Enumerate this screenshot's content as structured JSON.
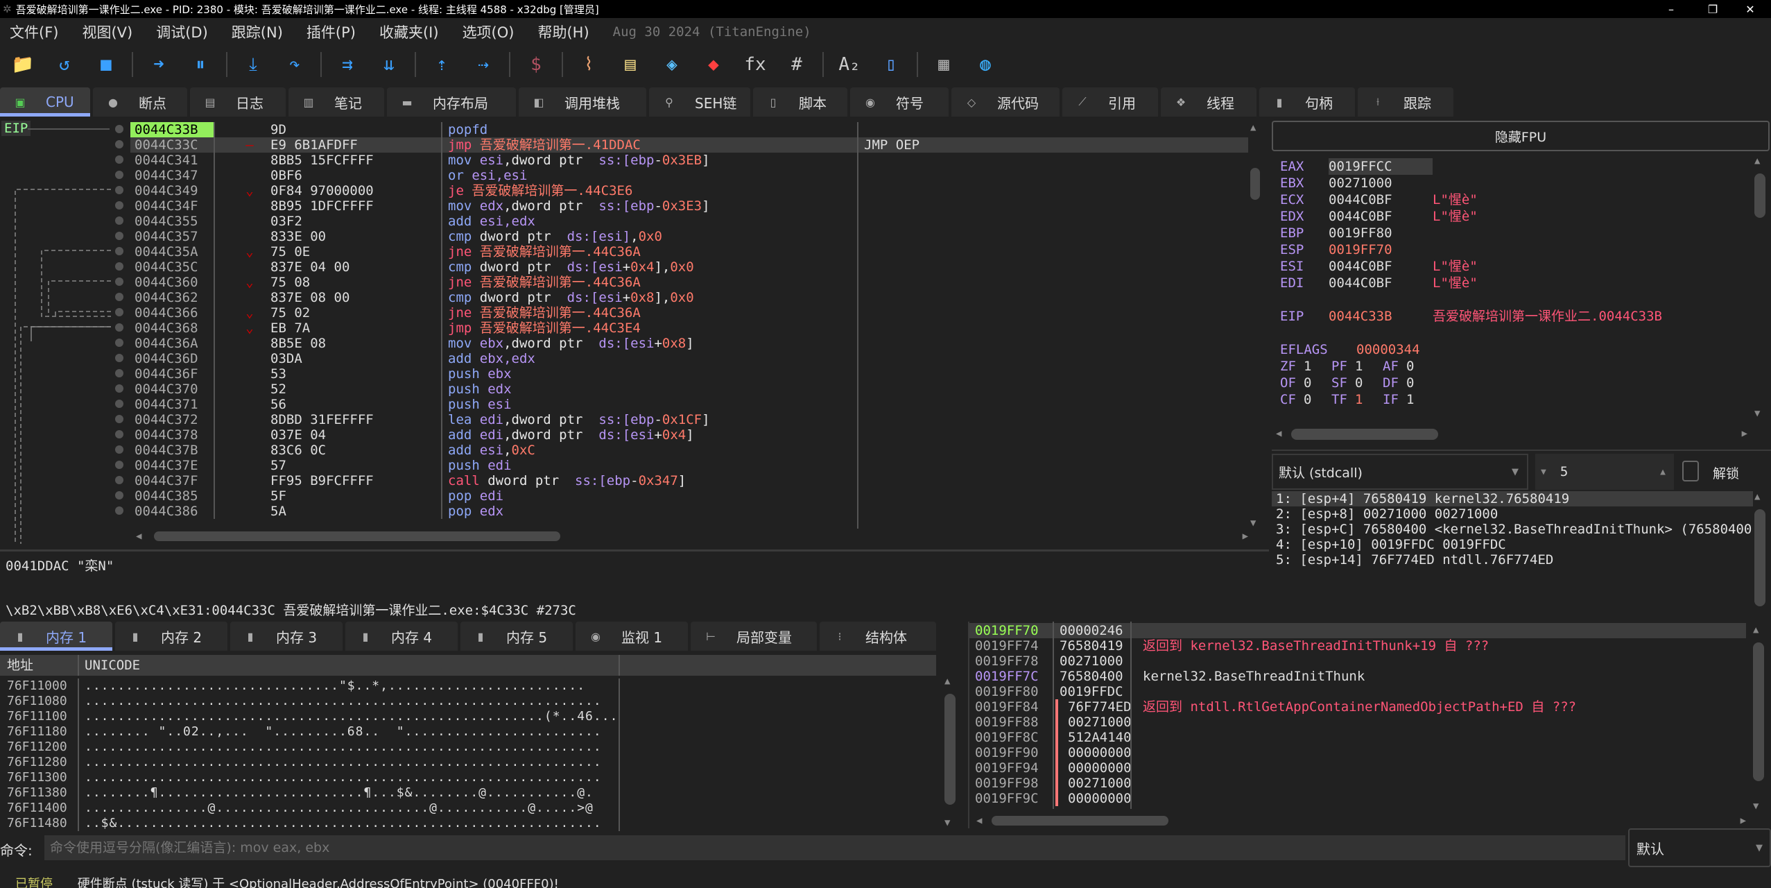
{
  "window": {
    "title": "吾爱破解培训第一课作业二.exe - PID: 2380 - 模块: 吾爱破解培训第一课作业二.exe - 线程: 主线程 4588 - x32dbg [管理员]",
    "min": "–",
    "max": "❐",
    "close": "✕"
  },
  "menu": {
    "items": [
      "文件(F)",
      "视图(V)",
      "调试(D)",
      "跟踪(N)",
      "插件(P)",
      "收藏夹(I)",
      "选项(O)",
      "帮助(H)"
    ],
    "version": "Aug 30 2024 (TitanEngine)"
  },
  "toolbar": {
    "icons": [
      "open-icon",
      "restart-icon",
      "stop-icon",
      "run-icon",
      "pause-icon",
      "step-into-icon",
      "step-over-icon",
      "trace-into-icon",
      "trace-over-icon",
      "execute-till-return-icon",
      "run-to-user-code-icon",
      "scylla-icon",
      "patch-icon",
      "comment-icon",
      "label-icon",
      "bookmark-icon",
      "function-icon",
      "hash-icon",
      "strings-icon",
      "calls-icon",
      "calculator-icon",
      "globe-icon"
    ],
    "glyphs": [
      "📁",
      "↺",
      "■",
      "➜",
      "⏸",
      "⤓",
      "↷",
      "⇉",
      "⇊",
      "⇡",
      "⇢",
      "$",
      "⌇",
      "▤",
      "◈",
      "◆",
      "fx",
      "#",
      "A₂",
      "▯",
      "▦",
      "◍"
    ]
  },
  "main_tabs": [
    {
      "label": "CPU",
      "icon": "▣"
    },
    {
      "label": "断点",
      "icon": "●"
    },
    {
      "label": "日志",
      "icon": "▤"
    },
    {
      "label": "笔记",
      "icon": "▥"
    },
    {
      "label": "内存布局",
      "icon": "▬"
    },
    {
      "label": "调用堆栈",
      "icon": "◧"
    },
    {
      "label": "SEH链",
      "icon": "⚲"
    },
    {
      "label": "脚本",
      "icon": "▯"
    },
    {
      "label": "符号",
      "icon": "◉"
    },
    {
      "label": "源代码",
      "icon": "◇"
    },
    {
      "label": "引用",
      "icon": "⟋"
    },
    {
      "label": "线程",
      "icon": "❖"
    },
    {
      "label": "句柄",
      "icon": "▮"
    },
    {
      "label": "跟踪",
      "icon": "⟊"
    }
  ],
  "eip_label": "EIP",
  "disasm": {
    "rows": [
      {
        "addr": "0044C33B",
        "bytes": "9D",
        "mark": "",
        "ins": [
          [
            "kw",
            "popfd"
          ]
        ],
        "comment": ""
      },
      {
        "addr": "0044C33C",
        "bytes": "E9 6B1AFDFF",
        "mark": "–",
        "ins": [
          [
            "jmp",
            "jmp "
          ],
          [
            "lbl",
            "吾爱破解培训第一.41DDAC"
          ]
        ],
        "comment": "JMP OEP"
      },
      {
        "addr": "0044C341",
        "bytes": "8BB5 15FCFFFF",
        "mark": "",
        "ins": [
          [
            "kw",
            "mov "
          ],
          [
            "reg",
            "esi"
          ],
          [
            "white",
            ",dword ptr  "
          ],
          [
            "reg",
            "ss:[ebp"
          ],
          [
            "white",
            "-"
          ],
          [
            "num",
            "0x3EB"
          ],
          [
            "white",
            "]"
          ]
        ],
        "comment": ""
      },
      {
        "addr": "0044C347",
        "bytes": "0BF6",
        "mark": "",
        "ins": [
          [
            "kw",
            "or "
          ],
          [
            "reg",
            "esi,esi"
          ]
        ],
        "comment": ""
      },
      {
        "addr": "0044C349",
        "bytes": "0F84 97000000",
        "mark": "⌄",
        "ins": [
          [
            "jmp",
            "je "
          ],
          [
            "lbl",
            "吾爱破解培训第一.44C3E6"
          ]
        ],
        "comment": ""
      },
      {
        "addr": "0044C34F",
        "bytes": "8B95 1DFCFFFF",
        "mark": "",
        "ins": [
          [
            "kw",
            "mov "
          ],
          [
            "reg",
            "edx"
          ],
          [
            "white",
            ",dword ptr  "
          ],
          [
            "reg",
            "ss:[ebp"
          ],
          [
            "white",
            "-"
          ],
          [
            "num",
            "0x3E3"
          ],
          [
            "white",
            "]"
          ]
        ],
        "comment": ""
      },
      {
        "addr": "0044C355",
        "bytes": "03F2",
        "mark": "",
        "ins": [
          [
            "kw",
            "add "
          ],
          [
            "reg",
            "esi,edx"
          ]
        ],
        "comment": ""
      },
      {
        "addr": "0044C357",
        "bytes": "833E 00",
        "mark": "",
        "ins": [
          [
            "kw",
            "cmp "
          ],
          [
            "white",
            "dword ptr  "
          ],
          [
            "reg",
            "ds:[esi]"
          ],
          [
            "white",
            ","
          ],
          [
            "num",
            "0x0"
          ]
        ],
        "comment": ""
      },
      {
        "addr": "0044C35A",
        "bytes": "75 0E",
        "mark": "⌄",
        "ins": [
          [
            "jmp",
            "jne "
          ],
          [
            "lbl",
            "吾爱破解培训第一.44C36A"
          ]
        ],
        "comment": ""
      },
      {
        "addr": "0044C35C",
        "bytes": "837E 04 00",
        "mark": "",
        "ins": [
          [
            "kw",
            "cmp "
          ],
          [
            "white",
            "dword ptr  "
          ],
          [
            "reg",
            "ds:[esi"
          ],
          [
            "white",
            "+"
          ],
          [
            "num",
            "0x4"
          ],
          [
            "white",
            "],"
          ],
          [
            "num",
            "0x0"
          ]
        ],
        "comment": ""
      },
      {
        "addr": "0044C360",
        "bytes": "75 08",
        "mark": "⌄",
        "ins": [
          [
            "jmp",
            "jne "
          ],
          [
            "lbl",
            "吾爱破解培训第一.44C36A"
          ]
        ],
        "comment": ""
      },
      {
        "addr": "0044C362",
        "bytes": "837E 08 00",
        "mark": "",
        "ins": [
          [
            "kw",
            "cmp "
          ],
          [
            "white",
            "dword ptr  "
          ],
          [
            "reg",
            "ds:[esi"
          ],
          [
            "white",
            "+"
          ],
          [
            "num",
            "0x8"
          ],
          [
            "white",
            "],"
          ],
          [
            "num",
            "0x0"
          ]
        ],
        "comment": ""
      },
      {
        "addr": "0044C366",
        "bytes": "75 02",
        "mark": "⌄",
        "ins": [
          [
            "jmp",
            "jne "
          ],
          [
            "lbl",
            "吾爱破解培训第一.44C36A"
          ]
        ],
        "comment": ""
      },
      {
        "addr": "0044C368",
        "bytes": "EB 7A",
        "mark": "⌄",
        "ins": [
          [
            "jmp",
            "jmp "
          ],
          [
            "lbl",
            "吾爱破解培训第一.44C3E4"
          ]
        ],
        "comment": ""
      },
      {
        "addr": "0044C36A",
        "bytes": "8B5E 08",
        "mark": "",
        "ins": [
          [
            "kw",
            "mov "
          ],
          [
            "reg",
            "ebx"
          ],
          [
            "white",
            ",dword ptr  "
          ],
          [
            "reg",
            "ds:[esi"
          ],
          [
            "white",
            "+"
          ],
          [
            "num",
            "0x8"
          ],
          [
            "white",
            "]"
          ]
        ],
        "comment": ""
      },
      {
        "addr": "0044C36D",
        "bytes": "03DA",
        "mark": "",
        "ins": [
          [
            "kw",
            "add "
          ],
          [
            "reg",
            "ebx,edx"
          ]
        ],
        "comment": ""
      },
      {
        "addr": "0044C36F",
        "bytes": "53",
        "mark": "",
        "ins": [
          [
            "kw",
            "push "
          ],
          [
            "reg",
            "ebx"
          ]
        ],
        "comment": ""
      },
      {
        "addr": "0044C370",
        "bytes": "52",
        "mark": "",
        "ins": [
          [
            "kw",
            "push "
          ],
          [
            "reg",
            "edx"
          ]
        ],
        "comment": ""
      },
      {
        "addr": "0044C371",
        "bytes": "56",
        "mark": "",
        "ins": [
          [
            "kw",
            "push "
          ],
          [
            "reg",
            "esi"
          ]
        ],
        "comment": ""
      },
      {
        "addr": "0044C372",
        "bytes": "8DBD 31FEFFFF",
        "mark": "",
        "ins": [
          [
            "kw",
            "lea "
          ],
          [
            "reg",
            "edi"
          ],
          [
            "white",
            ",dword ptr  "
          ],
          [
            "reg",
            "ss:[ebp"
          ],
          [
            "white",
            "-"
          ],
          [
            "num",
            "0x1CF"
          ],
          [
            "white",
            "]"
          ]
        ],
        "comment": ""
      },
      {
        "addr": "0044C378",
        "bytes": "037E 04",
        "mark": "",
        "ins": [
          [
            "kw",
            "add "
          ],
          [
            "reg",
            "edi"
          ],
          [
            "white",
            ",dword ptr  "
          ],
          [
            "reg",
            "ds:[esi"
          ],
          [
            "white",
            "+"
          ],
          [
            "num",
            "0x4"
          ],
          [
            "white",
            "]"
          ]
        ],
        "comment": ""
      },
      {
        "addr": "0044C37B",
        "bytes": "83C6 0C",
        "mark": "",
        "ins": [
          [
            "kw",
            "add "
          ],
          [
            "reg",
            "esi"
          ],
          [
            "white",
            ","
          ],
          [
            "num",
            "0xC"
          ]
        ],
        "comment": ""
      },
      {
        "addr": "0044C37E",
        "bytes": "57",
        "mark": "",
        "ins": [
          [
            "kw",
            "push "
          ],
          [
            "reg",
            "edi"
          ]
        ],
        "comment": ""
      },
      {
        "addr": "0044C37F",
        "bytes": "FF95 B9FCFFFF",
        "mark": "",
        "ins": [
          [
            "jmp",
            "call "
          ],
          [
            "white",
            "dword ptr  "
          ],
          [
            "reg",
            "ss:[ebp"
          ],
          [
            "white",
            "-"
          ],
          [
            "num",
            "0x347"
          ],
          [
            "white",
            "]"
          ]
        ],
        "comment": ""
      },
      {
        "addr": "0044C385",
        "bytes": "5F",
        "mark": "",
        "ins": [
          [
            "kw",
            "pop "
          ],
          [
            "reg",
            "edi"
          ]
        ],
        "comment": ""
      },
      {
        "addr": "0044C386",
        "bytes": "5A",
        "mark": "",
        "ins": [
          [
            "kw",
            "pop "
          ],
          [
            "reg",
            "edx"
          ]
        ],
        "comment": ""
      }
    ]
  },
  "info": {
    "line1": "0041DDAC \"栾N\"",
    "line2": "\\xB2\\xBB\\xB8\\xE6\\xC4\\xE31:0044C33C 吾爱破解培训第一课作业二.exe:$4C33C #273C"
  },
  "registers": {
    "hide_fpu": "隐藏FPU",
    "gp": [
      {
        "name": "EAX",
        "value": "0019FFCC",
        "comment": "",
        "highlight": false
      },
      {
        "name": "EBX",
        "value": "00271000",
        "comment": "",
        "highlight": false
      },
      {
        "name": "ECX",
        "value": "0044C0BF",
        "comment": "L\"惺è\"",
        "highlight": false
      },
      {
        "name": "EDX",
        "value": "0044C0BF",
        "comment": "L\"惺è\"",
        "highlight": false
      },
      {
        "name": "EBP",
        "value": "0019FF80",
        "comment": "",
        "highlight": false
      },
      {
        "name": "ESP",
        "value": "0019FF70",
        "comment": "",
        "highlight": true
      },
      {
        "name": "ESI",
        "value": "0044C0BF",
        "comment": "L\"惺è\"",
        "highlight": false
      },
      {
        "name": "EDI",
        "value": "0044C0BF",
        "comment": "L\"惺è\"",
        "highlight": false
      }
    ],
    "eip": {
      "name": "EIP",
      "value": "0044C33B",
      "comment": "吾爱破解培训第一课作业二.0044C33B"
    },
    "eflags": {
      "name": "EFLAGS",
      "value": "00000344"
    },
    "flags": [
      [
        [
          "ZF",
          "1",
          false
        ],
        [
          "PF",
          "1",
          false
        ],
        [
          "AF",
          "0",
          false
        ]
      ],
      [
        [
          "OF",
          "0",
          false
        ],
        [
          "SF",
          "0",
          false
        ],
        [
          "DF",
          "0",
          false
        ]
      ],
      [
        [
          "CF",
          "0",
          false
        ],
        [
          "TF",
          "1",
          true
        ],
        [
          "IF",
          "1",
          false
        ]
      ]
    ]
  },
  "callconv": {
    "selected": "默认 (stdcall)",
    "count": "5",
    "unlock_label": "解锁",
    "unlock_checked": false
  },
  "args": [
    "1: [esp+4] 76580419 kernel32.76580419",
    "2: [esp+8] 00271000 00271000",
    "3: [esp+C] 76580400 <kernel32.BaseThreadInitThunk> (76580400)",
    "4: [esp+10] 0019FFDC 0019FFDC",
    "5: [esp+14] 76F774ED ntdll.76F774ED"
  ],
  "dump_tabs": [
    {
      "label": "内存 1",
      "icon": "▮"
    },
    {
      "label": "内存 2",
      "icon": "▮"
    },
    {
      "label": "内存 3",
      "icon": "▮"
    },
    {
      "label": "内存 4",
      "icon": "▮"
    },
    {
      "label": "内存 5",
      "icon": "▮"
    },
    {
      "label": "监视 1",
      "icon": "◉"
    },
    {
      "label": "局部变量",
      "icon": "⊢"
    },
    {
      "label": "结构体",
      "icon": "⁝"
    }
  ],
  "dump": {
    "col_addr": "地址",
    "col_data": "UNICODE",
    "rows": [
      {
        "addr": "76F11000",
        "text": "...............................\"$..*,........................"
      },
      {
        "addr": "76F11080",
        "text": "..............................................................."
      },
      {
        "addr": "76F11100",
        "text": "........................................................(*..46... .."
      },
      {
        "addr": "76F11180",
        "text": "........ \"..02..,...  \".........68..  \"........................"
      },
      {
        "addr": "76F11200",
        "text": "..............................................................."
      },
      {
        "addr": "76F11280",
        "text": "..............................................................."
      },
      {
        "addr": "76F11300",
        "text": "..............................................................."
      },
      {
        "addr": "76F11380",
        "text": "........¶.........................¶...$&........@...........@."
      },
      {
        "addr": "76F11400",
        "text": "...............@..........................@...........@.....>@"
      },
      {
        "addr": "76F11480",
        "text": "..$&..........................................................."
      }
    ]
  },
  "stack": {
    "rows": [
      {
        "addr": "0019FF70",
        "value": "00000246",
        "comment": "",
        "kind": "esp"
      },
      {
        "addr": "0019FF74",
        "value": "76580419",
        "comment": "返回到 kernel32.BaseThreadInitThunk+19 自 ???",
        "kind": "ret"
      },
      {
        "addr": "0019FF78",
        "value": "00271000",
        "comment": "",
        "kind": ""
      },
      {
        "addr": "0019FF7C",
        "value": "76580400",
        "comment": "kernel32.BaseThreadInitThunk",
        "kind": "ebp"
      },
      {
        "addr": "0019FF80",
        "value": "0019FFDC",
        "comment": "",
        "kind": ""
      },
      {
        "addr": "0019FF84",
        "value": "76F774ED",
        "comment": "返回到 ntdll.RtlGetAppContainerNamedObjectPath+ED 自 ???",
        "kind": "ret"
      },
      {
        "addr": "0019FF88",
        "value": "00271000",
        "comment": "",
        "kind": ""
      },
      {
        "addr": "0019FF8C",
        "value": "512A4140",
        "comment": "",
        "kind": ""
      },
      {
        "addr": "0019FF90",
        "value": "00000000",
        "comment": "",
        "kind": ""
      },
      {
        "addr": "0019FF94",
        "value": "00000000",
        "comment": "",
        "kind": ""
      },
      {
        "addr": "0019FF98",
        "value": "00271000",
        "comment": "",
        "kind": ""
      },
      {
        "addr": "0019FF9C",
        "value": "00000000",
        "comment": "",
        "kind": ""
      }
    ]
  },
  "command": {
    "label": "命令:",
    "placeholder": "命令使用逗号分隔(像汇编语言): mov eax, ebx",
    "mode": "默认"
  },
  "status": {
    "state": "已暂停",
    "text": "硬件断点 (tstuck 读写) 于 <OptionalHeader.AddressOfEntryPoint> (0040FFF0)!"
  }
}
